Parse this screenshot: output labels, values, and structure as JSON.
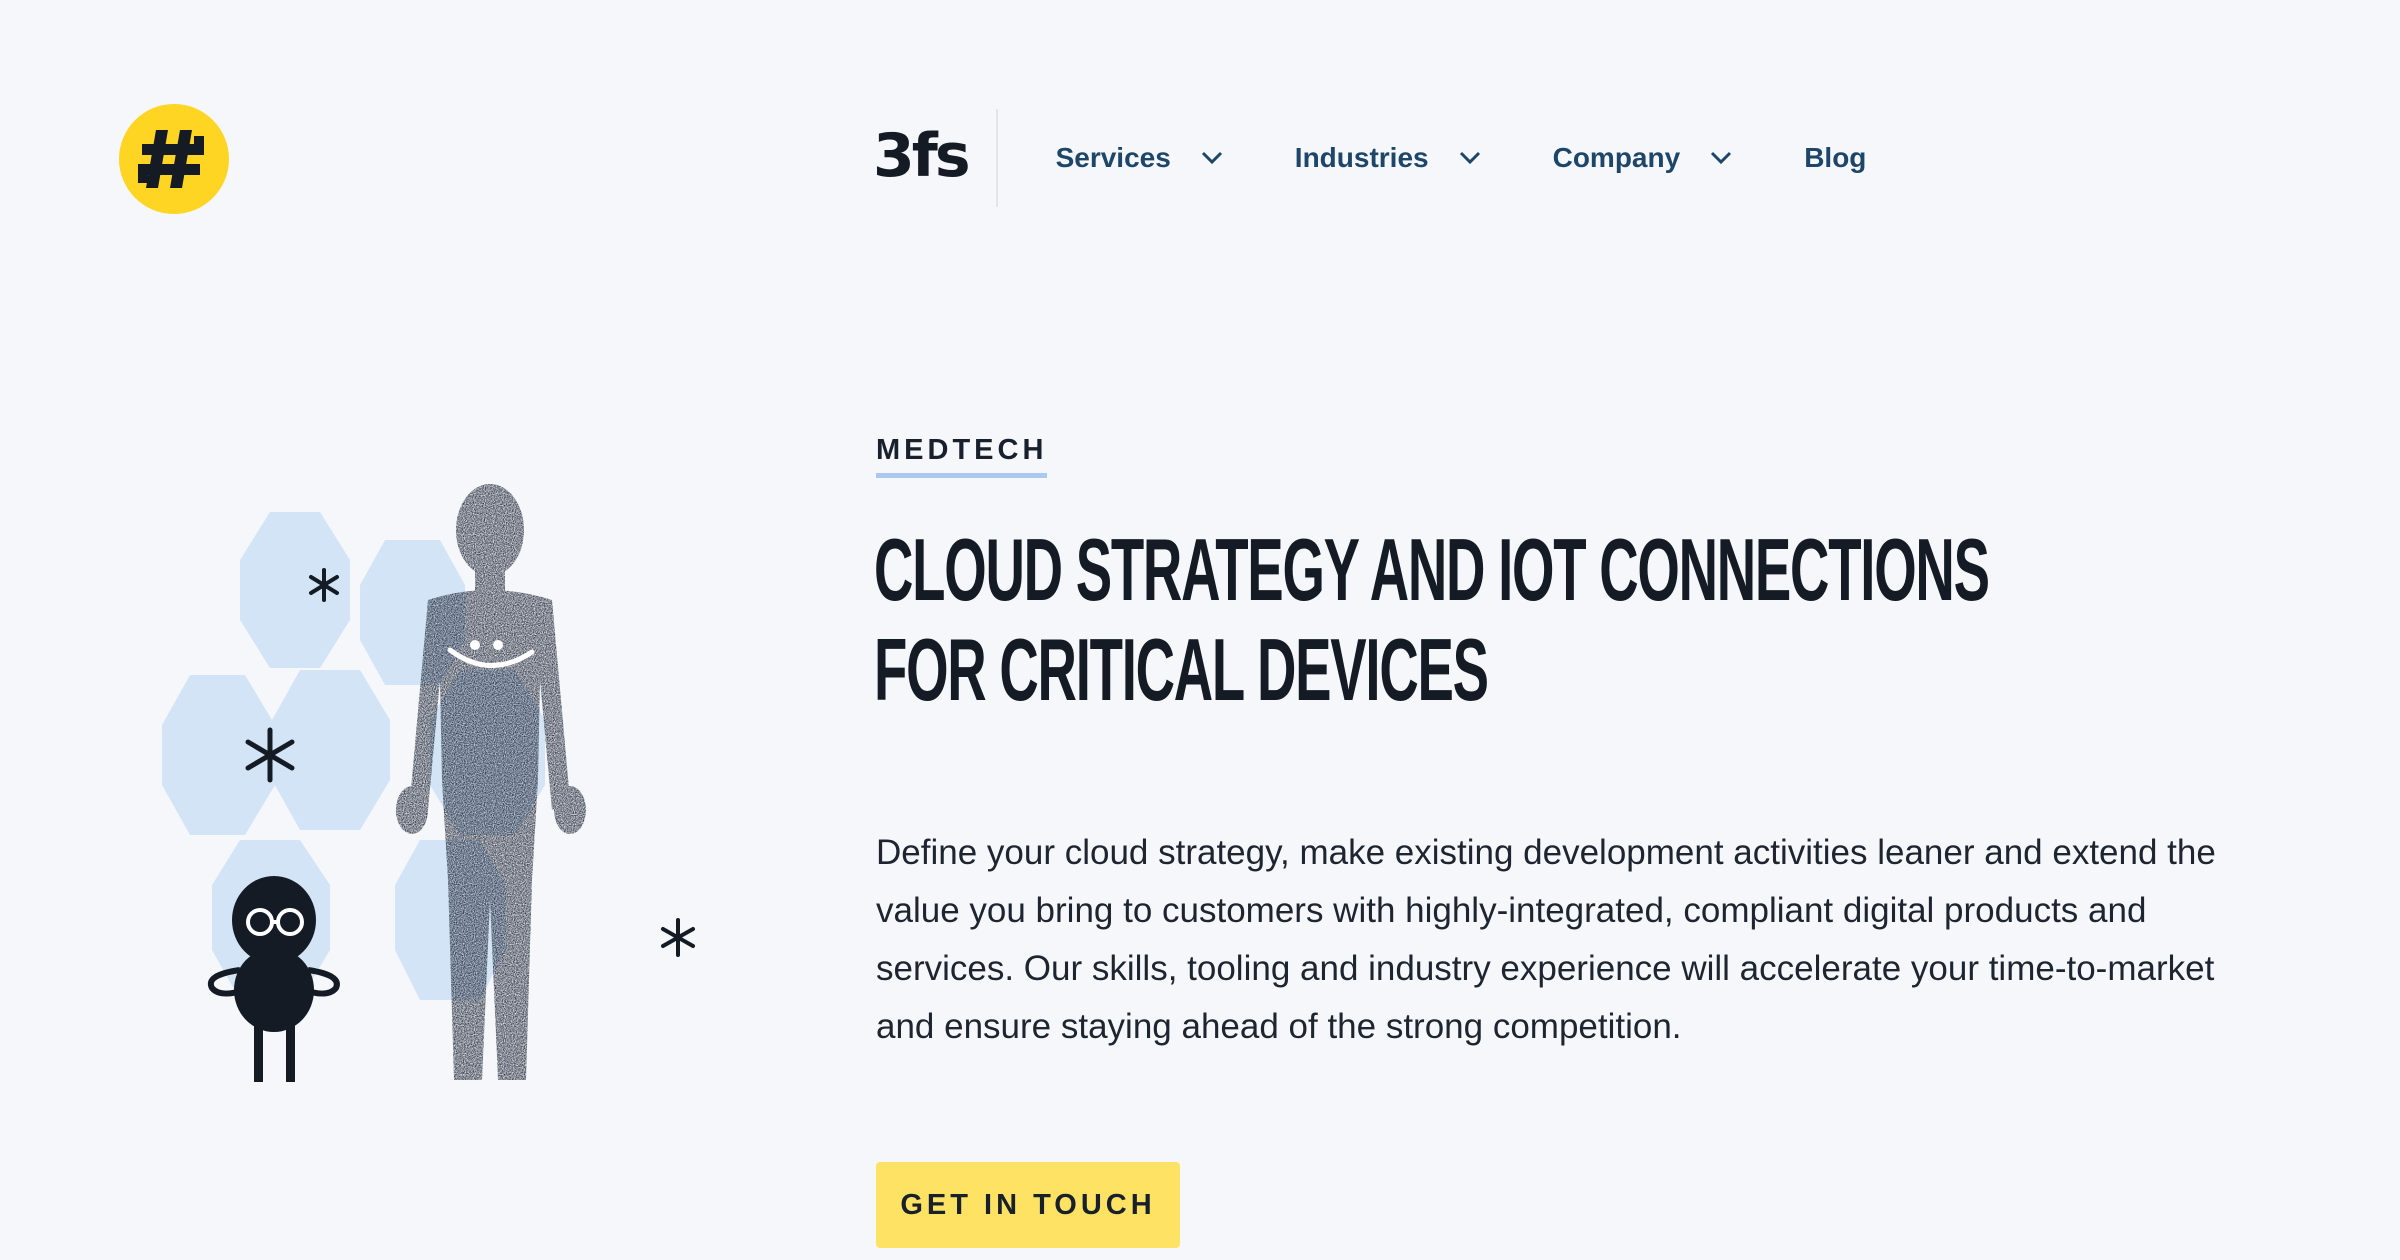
{
  "brand": {
    "logo_text": "3fs",
    "badge_icon": "hashtag-icon",
    "accent_color": "#fed523"
  },
  "nav": {
    "items": [
      {
        "label": "Services",
        "has_dropdown": true
      },
      {
        "label": "Industries",
        "has_dropdown": true
      },
      {
        "label": "Company",
        "has_dropdown": true
      },
      {
        "label": "Blog",
        "has_dropdown": false
      }
    ]
  },
  "hero": {
    "eyebrow": "MEDTECH",
    "headline_line1": "CLOUD STRATEGY AND IOT CONNECTIONS",
    "headline_line2": "FOR CRITICAL DEVICES",
    "description": "Define your cloud strategy, make existing development activities leaner and extend the value you bring to customers with highly-integrated, compliant digital products and services. Our skills, tooling and industry experience will accelerate your time-to-market and ensure staying ahead of the strong competition.",
    "cta_label": "GET IN TOUCH",
    "cta_color": "#fee264",
    "illustration_icons": [
      "human-figure-icon",
      "robot-character-icon",
      "asterisk-icon"
    ]
  },
  "colors": {
    "background": "#f6f7fb",
    "nav_text": "#1d4668",
    "hexagon_fill": "#d3e4f6",
    "eyebrow_underline": "#a9c9f1"
  }
}
